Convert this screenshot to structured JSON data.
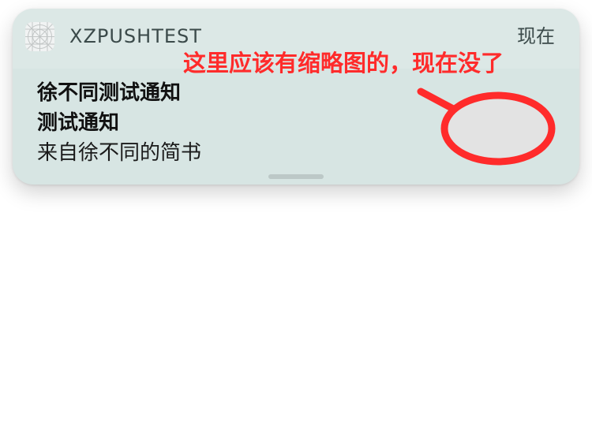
{
  "notification": {
    "app_name": "XZPUSHTEST",
    "timestamp": "现在",
    "title": "徐不同测试通知",
    "subtitle": "测试通知",
    "body": "来自徐不同的简书"
  },
  "annotation": {
    "text": "这里应该有缩略图的，现在没了",
    "color": "#ff2b2b"
  },
  "colors": {
    "notification_background": "#d7e5e3",
    "page_background": "#ffffff"
  },
  "icons": {
    "app": "placeholder-app-icon"
  }
}
